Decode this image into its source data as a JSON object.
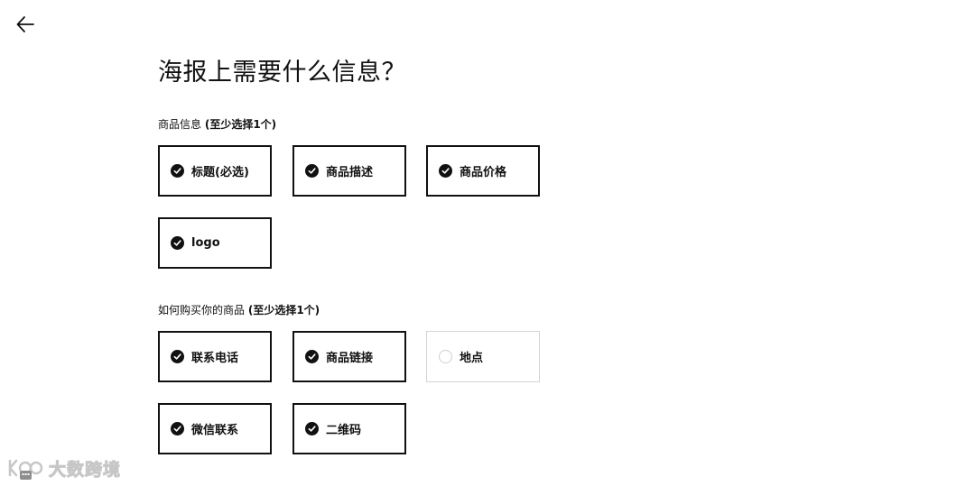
{
  "page": {
    "title": "海报上需要什么信息？"
  },
  "section_product": {
    "label": "商品信息",
    "hint": "(至少选择1个)",
    "options": [
      {
        "label": "标题(必选)",
        "checked": true
      },
      {
        "label": "商品描述",
        "checked": true
      },
      {
        "label": "商品价格",
        "checked": true
      },
      {
        "label": "logo",
        "checked": true
      }
    ]
  },
  "section_buy": {
    "label": "如何购买你的商品",
    "hint": "(至少选择1个)",
    "options": [
      {
        "label": "联系电话",
        "checked": true
      },
      {
        "label": "商品链接",
        "checked": true
      },
      {
        "label": "地点",
        "checked": false
      },
      {
        "label": "微信联系",
        "checked": true
      },
      {
        "label": "二维码",
        "checked": true
      }
    ]
  },
  "watermark": {
    "text": "大数跨境"
  },
  "colors": {
    "selected_border": "#111111",
    "unselected_border": "#d4d4d4",
    "background": "#ffffff"
  }
}
